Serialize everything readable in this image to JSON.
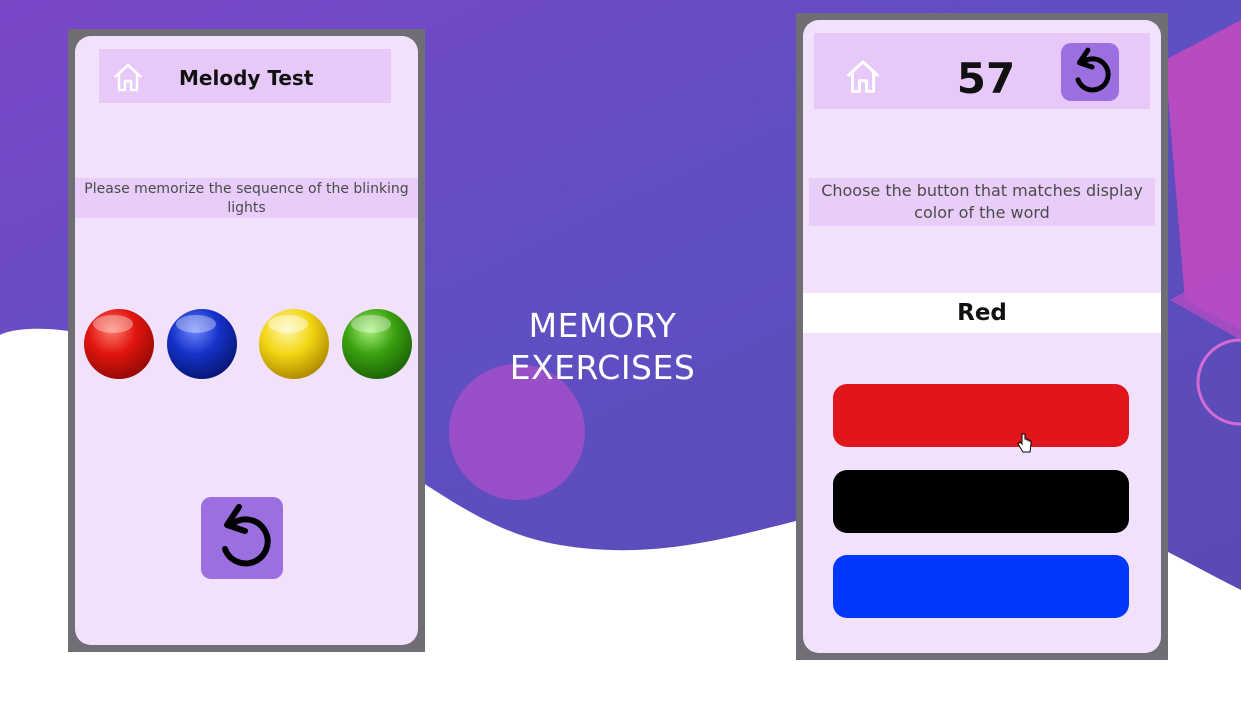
{
  "slide": {
    "title_line1": "MEMORY",
    "title_line2": "EXERCISES"
  },
  "melody_test": {
    "header_title": "Melody Test",
    "instruction": "Please memorize the sequence of the blinking lights",
    "lights": [
      {
        "name": "red-light",
        "color": "#e0140e"
      },
      {
        "name": "blue-light",
        "color": "#1432c8"
      },
      {
        "name": "yellow-light",
        "color": "#f2d614"
      },
      {
        "name": "green-light",
        "color": "#3aa10f"
      }
    ],
    "icons": [
      "home-icon",
      "reset-icon"
    ]
  },
  "stroop_test": {
    "score": "57",
    "instruction": "Choose the button that matches display color of the word",
    "word": "Red",
    "answer_buttons": [
      {
        "name": "red-answer-button",
        "color": "#e1161c"
      },
      {
        "name": "black-answer-button",
        "color": "#000000"
      },
      {
        "name": "blue-answer-button",
        "color": "#0037ff"
      }
    ],
    "icons": [
      "home-icon",
      "reset-icon"
    ]
  },
  "colors": {
    "background_purple": "#6a4bc4",
    "screen_bg": "#f1e1fb",
    "header_bg": "#e6c9f8",
    "button_purple": "#9b6fdf"
  }
}
